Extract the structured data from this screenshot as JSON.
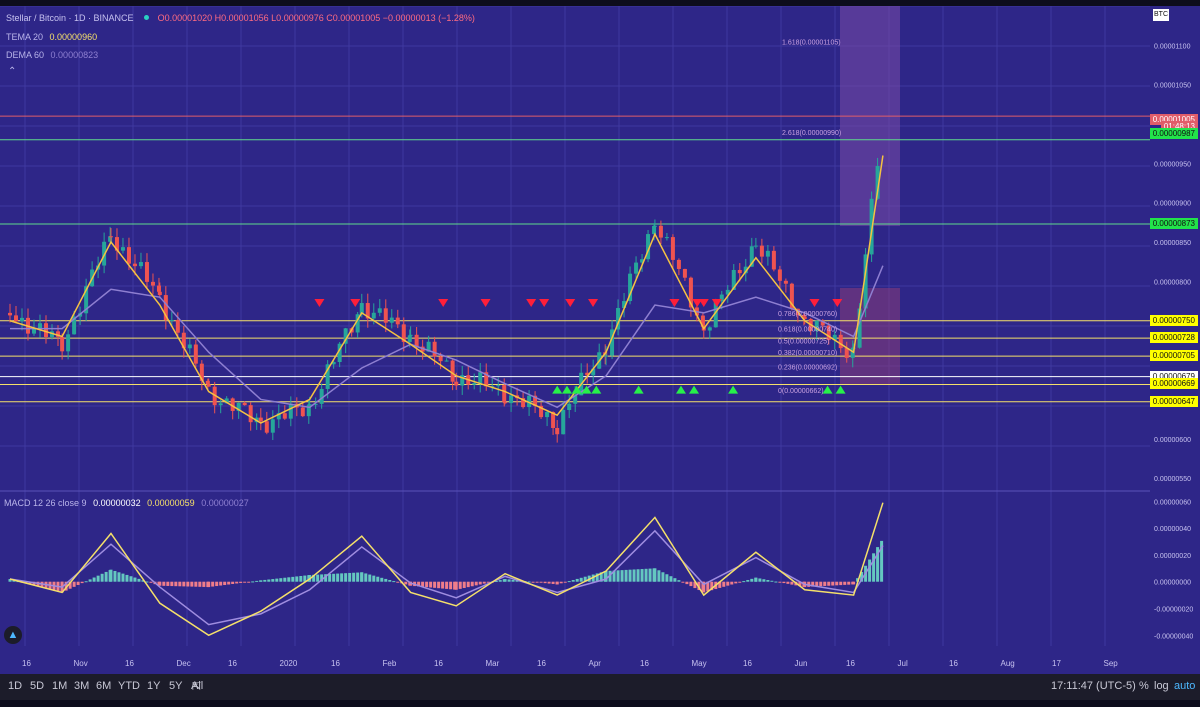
{
  "header": {
    "symbol": "Stellar / Bitcoin · 1D · BINANCE",
    "ohlc": "O0.00001020 H0.00001056 L0.00000976 C0.00001005 −0.00000013 (−1.28%)",
    "tema_label": "TEMA 20",
    "tema_value": "0.00000960",
    "dema_label": "DEMA 60",
    "dema_value": "0.00000823",
    "btc_badge": "BTC"
  },
  "macd_legend": {
    "label": "MACD 12 26 close 9",
    "v1": "0.00000032",
    "v2": "0.00000059",
    "v3": "0.00000027"
  },
  "price_axis_labels": [
    "0.00001100",
    "0.00001050",
    "0.00000950",
    "0.00000900",
    "0.00000850",
    "0.00000800",
    "0.00000600",
    "0.00000550"
  ],
  "macd_axis_labels": [
    "0.00000060",
    "0.00000040",
    "0.00000020",
    "0.00000000",
    "-0.00000020",
    "-0.00000040"
  ],
  "price_tags": [
    {
      "text": "0.00001005",
      "value": 1.005e-05,
      "bg": "#e05d6a",
      "fg": "#ffffff"
    },
    {
      "text": "01:48:13",
      "value": 9.96e-06,
      "bg": "#e05d6a",
      "fg": "#ffffff"
    },
    {
      "text": "0.00000987",
      "value": 9.87e-06,
      "bg": "#22e34a",
      "fg": "#111111"
    },
    {
      "text": "0.00000873",
      "value": 8.73e-06,
      "bg": "#22e34a",
      "fg": "#111111"
    },
    {
      "text": "0.00000750",
      "value": 7.5e-06,
      "bg": "#ffff00",
      "fg": "#111111"
    },
    {
      "text": "0.00000728",
      "value": 7.28e-06,
      "bg": "#ffff00",
      "fg": "#111111"
    },
    {
      "text": "0.00000705",
      "value": 7.05e-06,
      "bg": "#ffff00",
      "fg": "#111111"
    },
    {
      "text": "0.00000679",
      "value": 6.79e-06,
      "bg": "#ffffff",
      "fg": "#111111"
    },
    {
      "text": "0.00000669",
      "value": 6.69e-06,
      "bg": "#ffff00",
      "fg": "#111111"
    },
    {
      "text": "0.00000647",
      "value": 6.47e-06,
      "bg": "#ffff00",
      "fg": "#111111"
    }
  ],
  "x_labels": [
    "16",
    "Nov",
    "16",
    "Dec",
    "16",
    "2020",
    "16",
    "Feb",
    "16",
    "Mar",
    "16",
    "Apr",
    "16",
    "May",
    "16",
    "Jun",
    "16",
    "Jul",
    "16",
    "Aug",
    "17",
    "Sep"
  ],
  "fib_labels": [
    "1.618(0.00001105)",
    "2.618(0.00000990)",
    "0.786(0.00000760)",
    "0.618(0.00000740)",
    "0.5(0.00000725)",
    "0.382(0.00000710)",
    "0.236(0.00000692)",
    "0(0.00000662)"
  ],
  "timeframes": [
    "1D",
    "5D",
    "1M",
    "3M",
    "6M",
    "YTD",
    "1Y",
    "5Y",
    "All"
  ],
  "status": {
    "clock": "17:11:47 (UTC-5)",
    "percent": "%",
    "log": "log",
    "auto": "auto"
  },
  "colors": {
    "background": "#2e2688",
    "up": "#26a69a",
    "down": "#ef5350",
    "tema": "#f5c242",
    "dema": "#8e7fd1",
    "macd": "#f5e06a",
    "signal": "#9f8de0"
  },
  "chart_data": [
    {
      "type": "candlestick",
      "title": "Stellar / Bitcoin · 1D · BINANCE",
      "ylim": [
        5.4e-06,
        1.15e-05
      ],
      "x": [
        "Oct-16",
        "Nov-01",
        "Nov-16",
        "Dec-01",
        "Dec-16",
        "Jan-01",
        "Jan-16",
        "Feb-01",
        "Feb-16",
        "Mar-01",
        "Mar-16",
        "Apr-01",
        "Apr-16",
        "May-01",
        "May-16",
        "Jun-01",
        "Jun-16",
        "Jul-01",
        "Jul-10"
      ],
      "close": [
        7.6e-06,
        7.2e-06,
        8.6e-06,
        7.8e-06,
        6.6e-06,
        6.2e-06,
        6.4e-06,
        7.7e-06,
        7.3e-06,
        6.8e-06,
        6.6e-06,
        6.2e-06,
        7.2e-06,
        8.8e-06,
        7.4e-06,
        8.5e-06,
        7.5e-06,
        7.1e-06,
        1.005e-05
      ],
      "series": [
        {
          "name": "TEMA 20",
          "values": [
            7.5e-06,
            7.3e-06,
            8.5e-06,
            7.7e-06,
            6.6e-06,
            6.2e-06,
            6.5e-06,
            7.6e-06,
            7.2e-06,
            6.8e-06,
            6.6e-06,
            6.3e-06,
            7.1e-06,
            8.6e-06,
            7.4e-06,
            8.3e-06,
            7.5e-06,
            7.1e-06,
            9.6e-06
          ]
        },
        {
          "name": "DEMA 60",
          "values": [
            7.4e-06,
            7.4e-06,
            7.9e-06,
            7.8e-06,
            7.1e-06,
            6.5e-06,
            6.4e-06,
            6.9e-06,
            7.2e-06,
            7e-06,
            6.7e-06,
            6.4e-06,
            6.8e-06,
            7.7e-06,
            7.6e-06,
            7.8e-06,
            7.6e-06,
            7.3e-06,
            8.2e-06
          ]
        }
      ],
      "horizontal_lines": [
        9.8e-06,
        8.73e-06,
        7.5e-06,
        7.28e-06,
        7.05e-06,
        6.79e-06,
        6.69e-06,
        6.47e-06
      ],
      "sell_signals": [
        "Jan-19",
        "Jan-30",
        "Feb-26",
        "Mar-10",
        "Mar-24",
        "Mar-28",
        "Apr-05",
        "Apr-12",
        "May-07",
        "May-14",
        "May-16",
        "May-20",
        "Jun-19",
        "Jun-26"
      ],
      "buy_signals": [
        "Apr-01",
        "Apr-04",
        "Apr-07",
        "Apr-10",
        "Apr-13",
        "Apr-26",
        "May-09",
        "May-13",
        "May-25",
        "Jun-23",
        "Jun-27"
      ]
    },
    {
      "type": "bar",
      "title": "MACD 12 26 close 9",
      "ylim": [
        -4.8e-07,
        6.4e-07
      ],
      "x": [
        "Oct-16",
        "Nov-01",
        "Nov-16",
        "Dec-01",
        "Dec-16",
        "Jan-01",
        "Jan-16",
        "Feb-01",
        "Feb-16",
        "Mar-01",
        "Mar-16",
        "Apr-01",
        "Apr-16",
        "May-01",
        "May-16",
        "Jun-01",
        "Jun-16",
        "Jul-01",
        "Jul-10"
      ],
      "histogram": [
        2e-08,
        -8e-08,
        9e-08,
        -3e-08,
        -4e-08,
        1e-08,
        5e-08,
        7e-08,
        -3e-08,
        -6e-08,
        2e-08,
        -2e-08,
        8e-08,
        1e-07,
        -8e-08,
        3e-08,
        -4e-08,
        -2e-08,
        3.2e-07
      ],
      "series": [
        {
          "name": "MACD",
          "values": [
            2e-08,
            -8e-08,
            3.6e-07,
            -1.6e-07,
            -4e-07,
            -2.2e-07,
            2e-08,
            3.4e-07,
            -8e-08,
            -1.8e-07,
            6e-08,
            -1e-07,
            8e-08,
            4.8e-07,
            -1e-07,
            2.2e-07,
            -6e-08,
            -1e-07,
            5.9e-07
          ]
        },
        {
          "name": "Signal",
          "values": [
            2e-08,
            -4e-08,
            2.8e-07,
            -4e-08,
            -3.2e-07,
            -2.4e-07,
            -6e-08,
            2.6e-07,
            -1e-08,
            -1.2e-07,
            4e-08,
            -8e-08,
            2e-08,
            3.8e-07,
            -2e-08,
            1.8e-07,
            -2e-08,
            -8e-08,
            2.7e-07
          ]
        }
      ]
    }
  ]
}
